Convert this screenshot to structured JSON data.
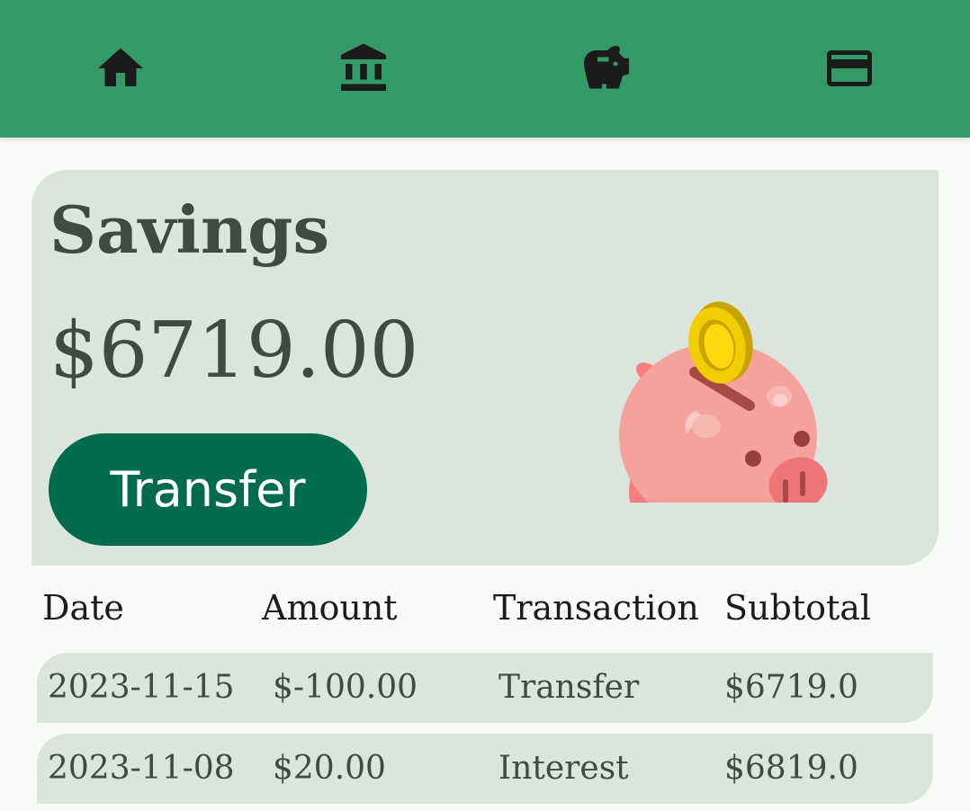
{
  "nav": {
    "items": [
      {
        "name": "home",
        "icon": "home-icon"
      },
      {
        "name": "bank",
        "icon": "bank-icon"
      },
      {
        "name": "savings",
        "icon": "piggy-bank-icon"
      },
      {
        "name": "card",
        "icon": "credit-card-icon"
      }
    ],
    "bar_color": "#349b68"
  },
  "account": {
    "title": "Savings",
    "balance": "$6719.00",
    "transfer_label": "Transfer",
    "illustration": "piggy-bank-with-coin-illustration"
  },
  "transactions": {
    "columns": [
      "Date",
      "Amount",
      "Transaction",
      "Subtotal"
    ],
    "rows": [
      {
        "date": "2023-11-15",
        "amount": "$-100.00",
        "type": "Transfer",
        "subtotal": "$6719.0"
      },
      {
        "date": "2023-11-08",
        "amount": "$20.00",
        "type": "Interest",
        "subtotal": "$6819.0"
      }
    ]
  },
  "colors": {
    "accent": "#349b68",
    "button": "#006c4b",
    "card": "#dbe5de",
    "text": "#404943"
  }
}
